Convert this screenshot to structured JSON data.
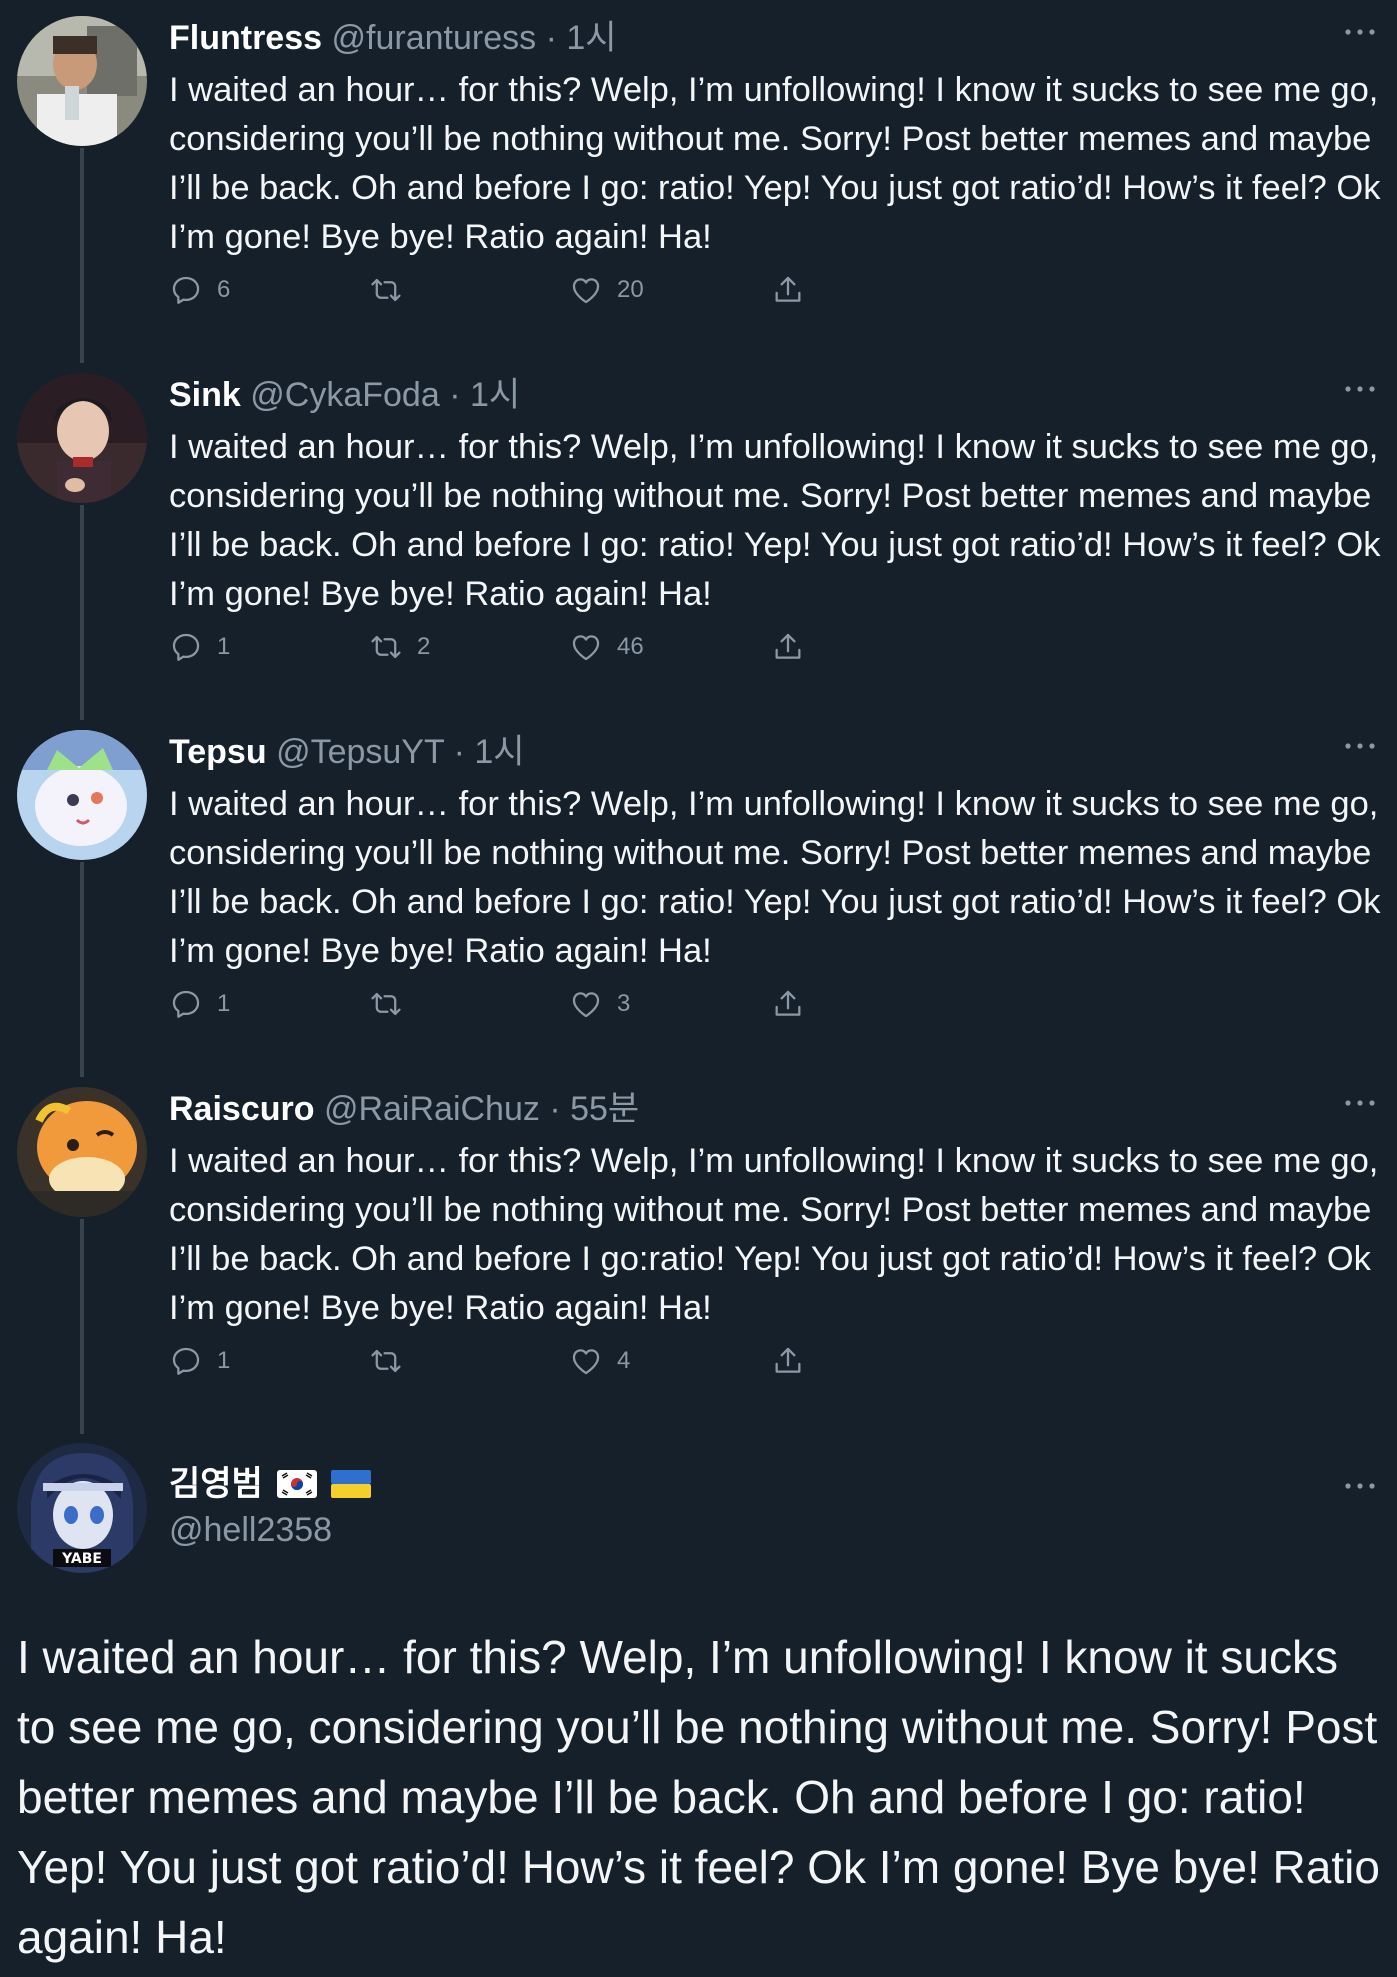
{
  "replies": [
    {
      "name": "Fluntress",
      "handle": "@furanturess",
      "separator": "·",
      "time": "1시",
      "text": "I waited an hour… for this? Welp, I’m unfollowing! I know it sucks to see me go, considering you’ll be nothing without me. Sorry! Post better memes and maybe I’ll be back. Oh and before I go: ratio! Yep! You just got ratio’d! How’s it feel? Ok I’m gone! Bye bye! Ratio again! Ha!",
      "replies_count": "6",
      "retweets_count": "",
      "likes_count": "20"
    },
    {
      "name": "Sink",
      "handle": "@CykaFoda",
      "separator": "·",
      "time": "1시",
      "text": "I waited an hour… for this? Welp, I’m unfollowing! I know it sucks to see me go, considering you’ll be nothing without me. Sorry! Post better memes and maybe I’ll be back. Oh and before I go: ratio! Yep! You just got ratio’d! How’s it feel? Ok I’m gone! Bye bye! Ratio again! Ha!",
      "replies_count": "1",
      "retweets_count": "2",
      "likes_count": "46"
    },
    {
      "name": "Tepsu",
      "handle": "@TepsuYT",
      "separator": "·",
      "time": "1시",
      "text": "I waited an hour… for this? Welp, I’m unfollowing! I know it sucks to see me go, considering you’ll be nothing without me. Sorry! Post better memes and maybe I’ll be back. Oh and before I go: ratio! Yep! You just got ratio’d! How’s it feel? Ok I’m gone! Bye bye! Ratio again! Ha!",
      "replies_count": "1",
      "retweets_count": "",
      "likes_count": "3"
    },
    {
      "name": "Raiscuro",
      "handle": "@RaiRaiChuz",
      "separator": "·",
      "time": "55분",
      "text": "I waited an hour… for this? Welp, I’m unfollowing! I know it sucks to see me go, considering you’ll be nothing without me. Sorry! Post better memes and maybe I’ll be back. Oh and before I go:ratio! Yep! You just got ratio’d! How’s it feel? Ok I’m gone! Bye bye! Ratio again! Ha!",
      "replies_count": "1",
      "retweets_count": "",
      "likes_count": "4"
    }
  ],
  "main_tweet": {
    "name": "김영범",
    "flags": [
      "korea-flag",
      "ukraine-flag"
    ],
    "handle": "@hell2358",
    "avatar_badge": "YABE",
    "text": "I waited an hour… for this? Welp, I’m unfollowing! I know it sucks to see me go, considering you’ll be nothing without me. Sorry! Post better memes and maybe I’ll be back. Oh and before I go: ratio! Yep! You just got ratio’d! How’s it feel? Ok I’m gone! Bye bye! Ratio again! Ha!"
  },
  "colors": {
    "background": "#15202b",
    "secondary_text": "#8b98a5",
    "thread_line": "#38444d"
  }
}
